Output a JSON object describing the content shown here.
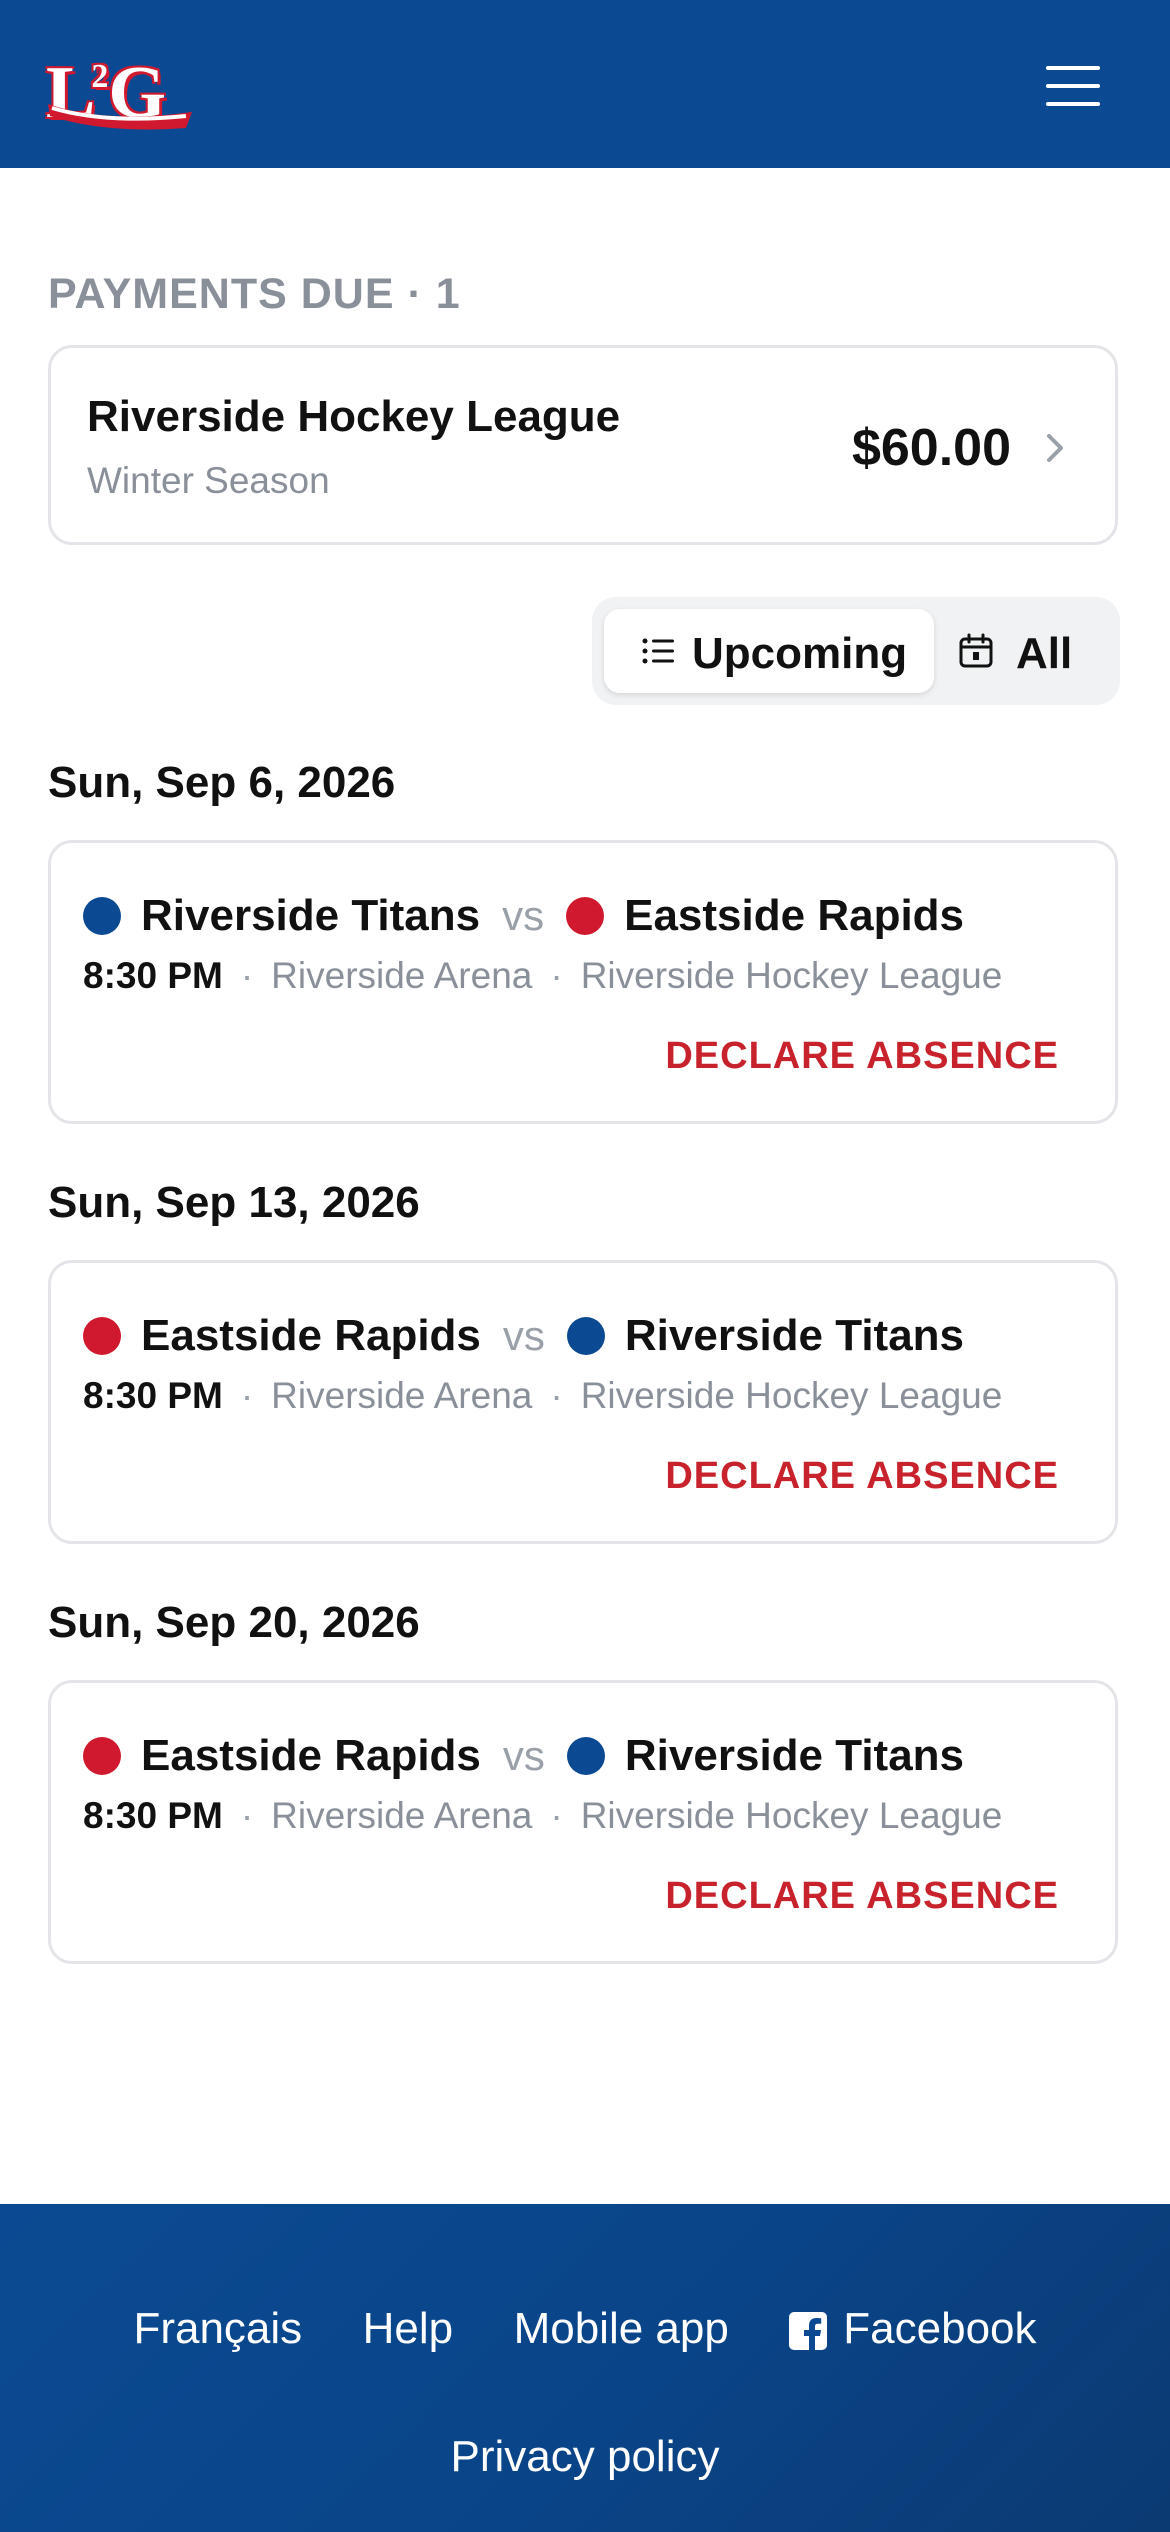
{
  "header": {
    "logo_text": "L",
    "logo_sup": "2",
    "logo_text2": "G",
    "menu_icon": "hamburger-menu-icon"
  },
  "payments": {
    "title": "PAYMENTS DUE · 1",
    "items": [
      {
        "league": "Riverside Hockey League",
        "season": "Winter Season",
        "amount": "$60.00"
      }
    ]
  },
  "filter": {
    "upcoming_label": "Upcoming",
    "all_label": "All",
    "upcoming_icon": "list-icon",
    "all_icon": "calendar-icon",
    "selected": "Upcoming"
  },
  "schedule": [
    {
      "date": "Sun, Sep 6, 2026",
      "home": {
        "name": "Riverside Titans",
        "color": "#0b4a92"
      },
      "vs": "vs",
      "away": {
        "name": "Eastside Rapids",
        "color": "#d0192e"
      },
      "time": "8:30 PM",
      "venue": "Riverside Arena",
      "league": "Riverside Hockey League",
      "action": "DECLARE ABSENCE"
    },
    {
      "date": "Sun, Sep 13, 2026",
      "home": {
        "name": "Eastside Rapids",
        "color": "#d0192e"
      },
      "vs": "vs",
      "away": {
        "name": "Riverside Titans",
        "color": "#0b4a92"
      },
      "time": "8:30 PM",
      "venue": "Riverside Arena",
      "league": "Riverside Hockey League",
      "action": "DECLARE ABSENCE"
    },
    {
      "date": "Sun, Sep 20, 2026",
      "home": {
        "name": "Eastside Rapids",
        "color": "#d0192e"
      },
      "vs": "vs",
      "away": {
        "name": "Riverside Titans",
        "color": "#0b4a92"
      },
      "time": "8:30 PM",
      "venue": "Riverside Arena",
      "league": "Riverside Hockey League",
      "action": "DECLARE ABSENCE"
    }
  ],
  "footer": {
    "links": [
      "Français",
      "Help",
      "Mobile app",
      "Facebook"
    ],
    "facebook_icon": "facebook-icon",
    "privacy": "Privacy policy"
  },
  "colors": {
    "brand_blue": "#0b4a92",
    "brand_red": "#d0192e",
    "action_red": "#c8222c",
    "muted_gray": "#8a9099"
  }
}
